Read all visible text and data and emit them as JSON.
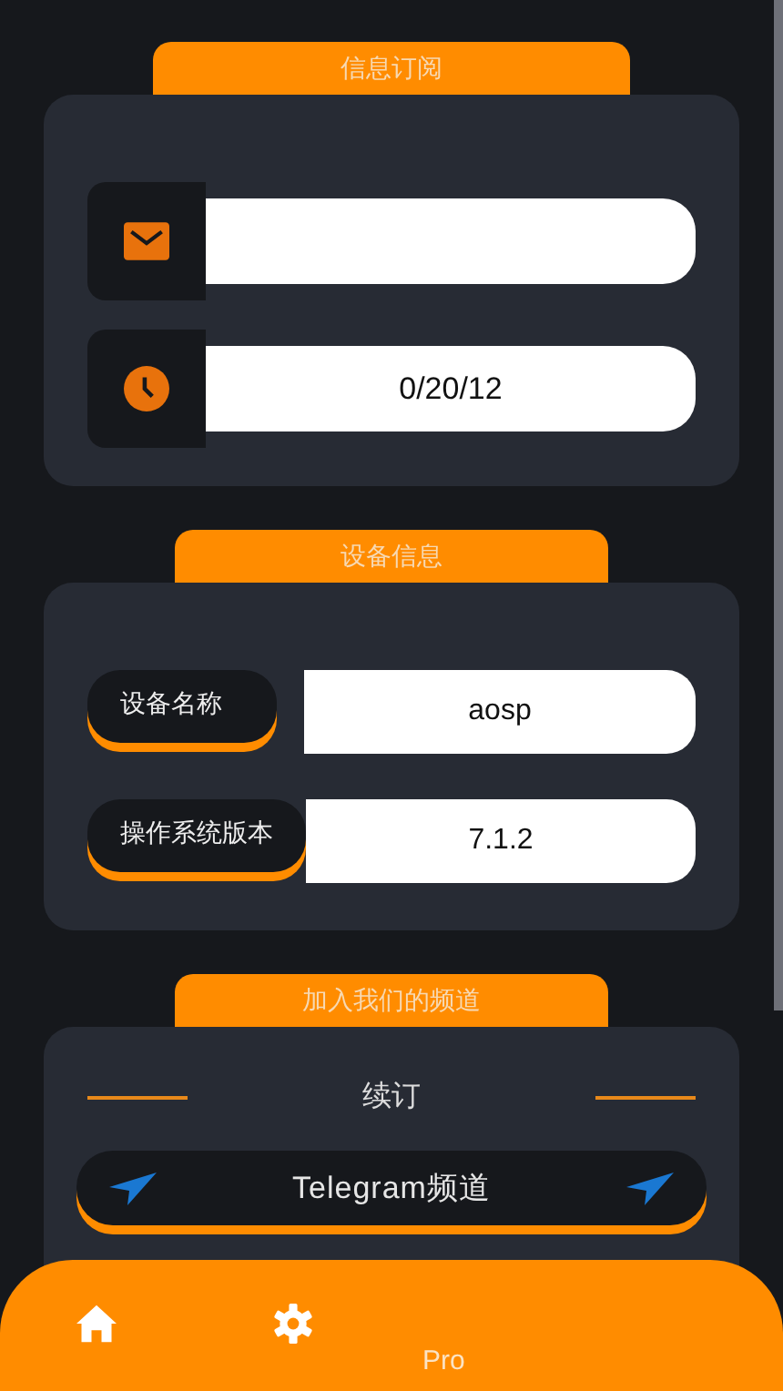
{
  "subscription": {
    "title": "信息订阅",
    "fields": [
      {
        "kind": "email"
      },
      {
        "kind": "date",
        "value": "0/20/12"
      }
    ]
  },
  "device": {
    "title": "设备信息",
    "rows": [
      {
        "label": "设备名称",
        "value": "aosp"
      },
      {
        "label": "操作系统版本",
        "value": "7.1.2"
      }
    ]
  },
  "channel": {
    "title": "加入我们的频道",
    "heading": "续订",
    "button": "Telegram频道"
  },
  "nav": [
    {
      "kind": "home"
    },
    {
      "kind": "settings"
    },
    {
      "kind": "text",
      "label": "Pro"
    }
  ]
}
